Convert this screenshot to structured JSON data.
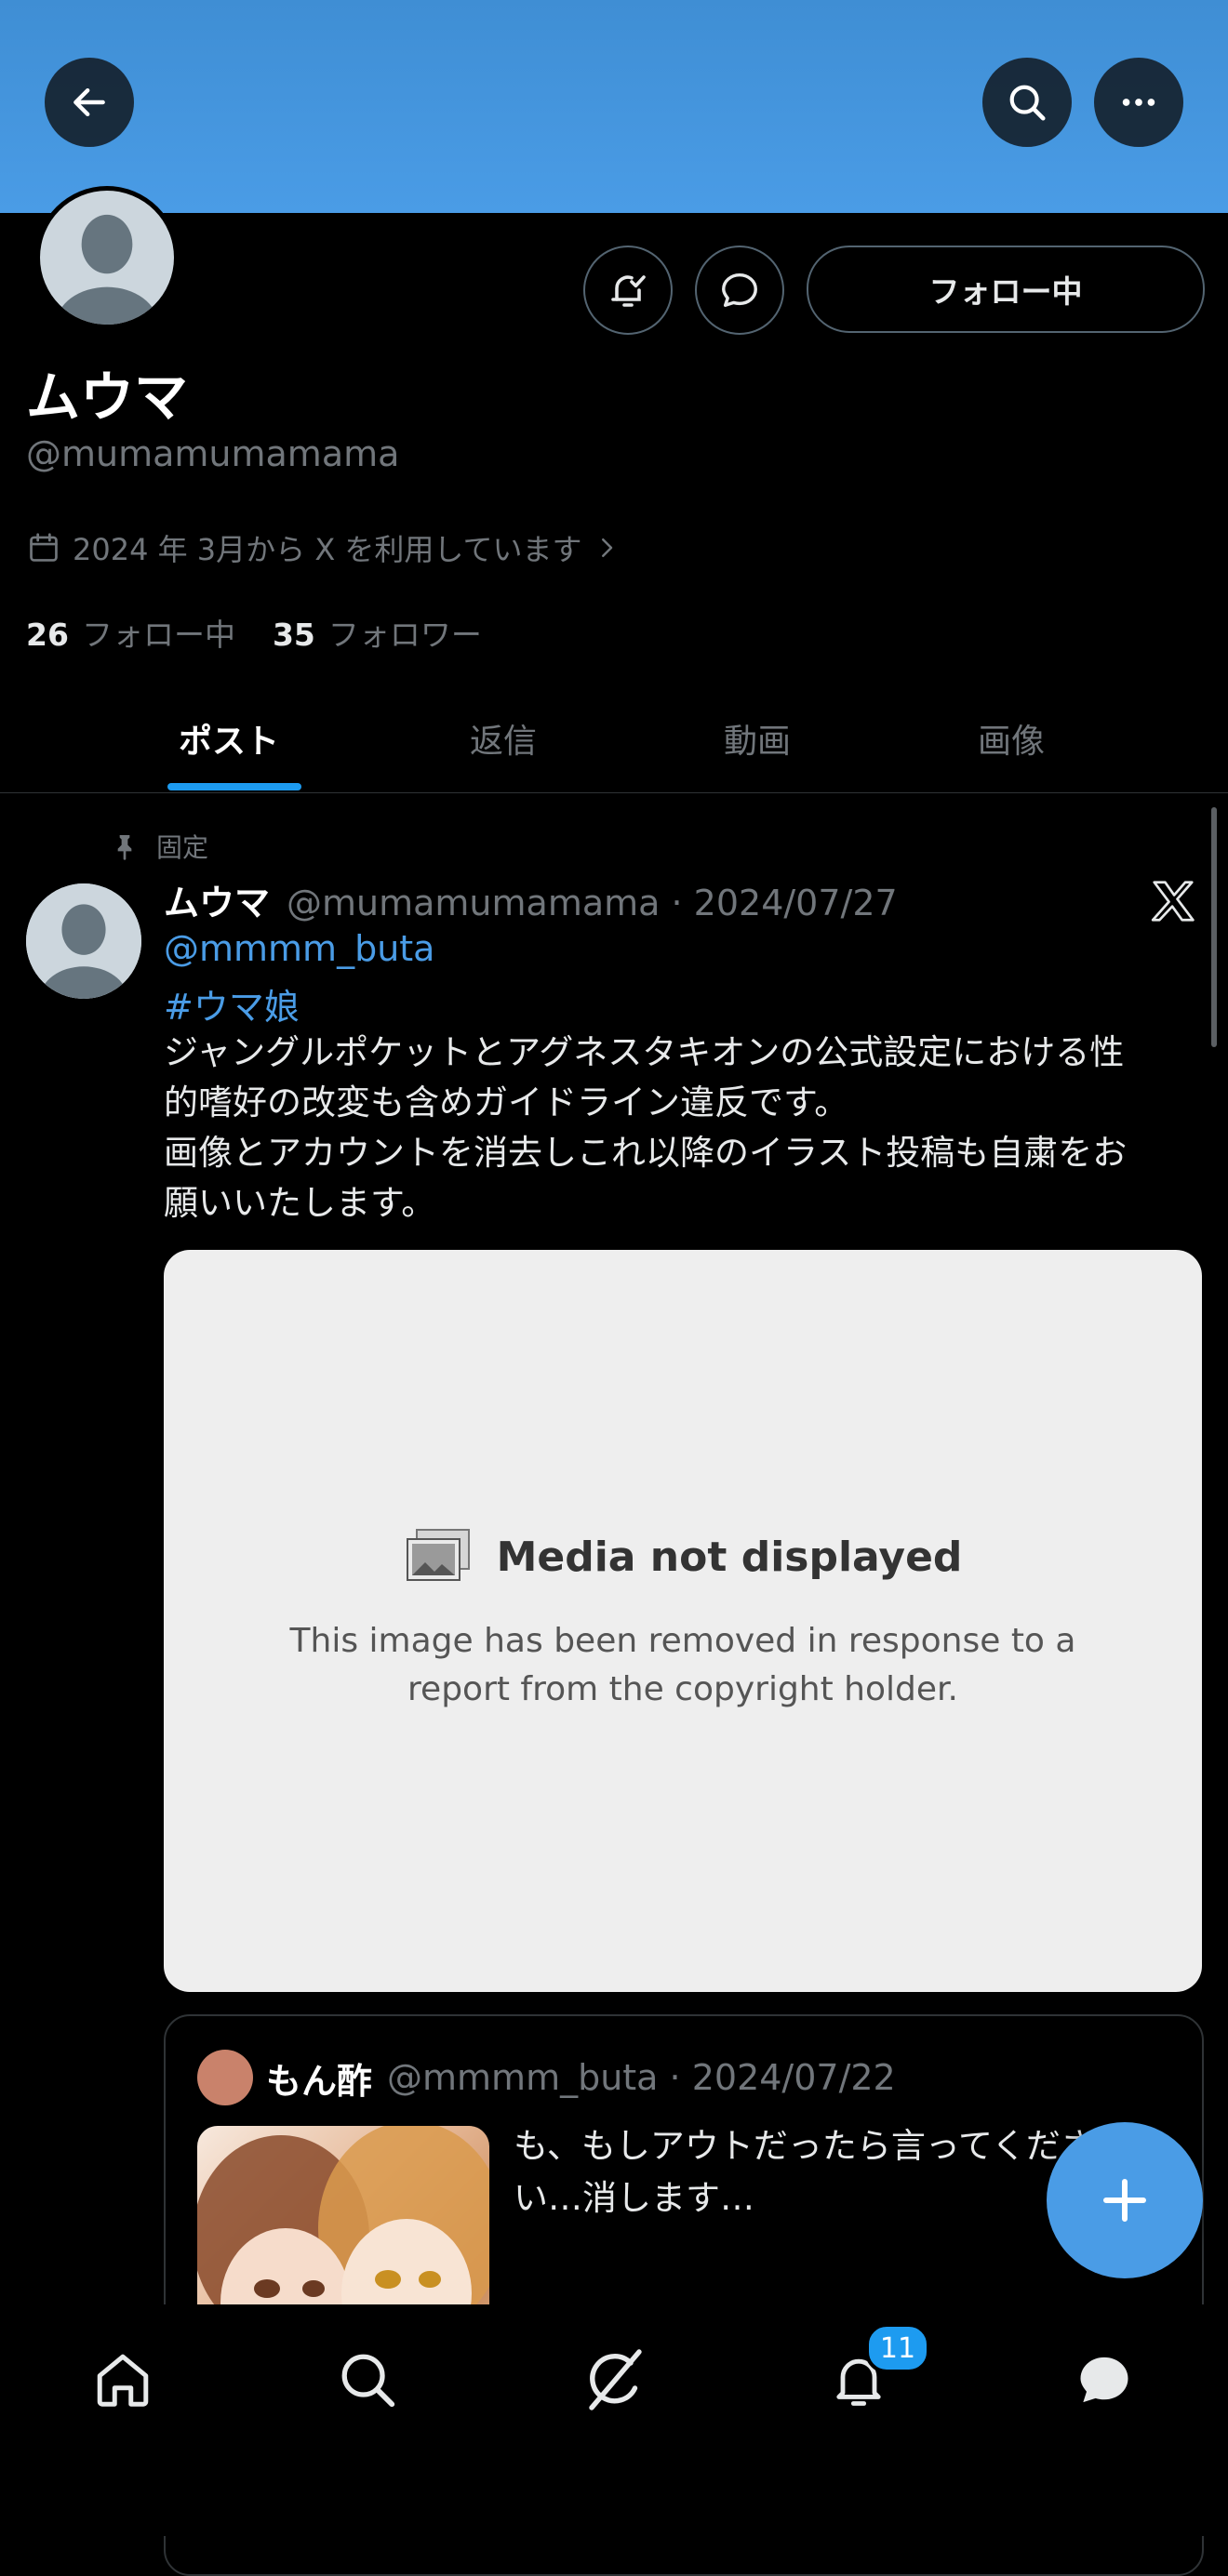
{
  "profile": {
    "name": "ムウマ",
    "handle": "@mumamumamama",
    "joined": "2024 年 3月から X を利用しています",
    "following_count": "26",
    "following_label": "フォロー中",
    "followers_count": "35",
    "followers_label": "フォロワー",
    "follow_button": "フォロー中"
  },
  "tabs": [
    {
      "label": "ポスト",
      "active": true
    },
    {
      "label": "返信"
    },
    {
      "label": "動画"
    },
    {
      "label": "画像"
    }
  ],
  "post": {
    "pinned_label": "固定",
    "author_name": "ムウマ",
    "author_handle_date": "@mumamumamama · 2024/07/27",
    "mention": "@mmmm_buta",
    "hashtag": "#ウマ娘",
    "text_line1": "ジャングルポケットとアグネスタキオンの公式設定における性",
    "text_line2": "的嗜好の改変も含めガイドライン違反です。",
    "text_line3": "画像とアカウントを消去しこれ以降のイラスト投稿も自粛をお",
    "text_line4": "願いいたします。",
    "media_title": "Media not displayed",
    "media_message": "This image has been removed in response to a report from the copyright holder."
  },
  "quote": {
    "author_name": "もん酢",
    "author_handle_date": "@mmmm_buta · 2024/07/22",
    "text": "も、もしアウトだったら言ってください…消します…"
  },
  "nav": {
    "notifications_badge": "11"
  },
  "icons": {
    "back": "arrow-left-icon",
    "search": "search-icon",
    "more": "more-dots-icon",
    "notify": "bell-check-icon",
    "message": "message-bubble-icon",
    "calendar": "calendar-icon",
    "pin": "pin-icon",
    "x_logo": "x-logo-icon",
    "compose": "plus-icon"
  },
  "colors": {
    "banner": "#4a9ce6",
    "accent": "#1d9bf0",
    "link": "#4a9ce6",
    "background": "#000000"
  }
}
